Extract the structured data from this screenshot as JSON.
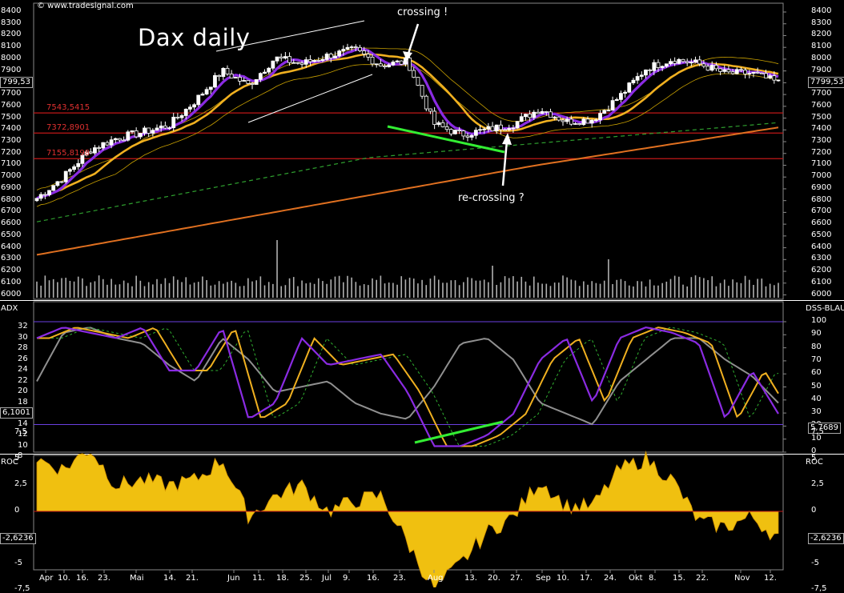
{
  "header": {
    "watermark": "© www.tradesignal.com",
    "title": "Dax daily"
  },
  "annotations": {
    "crossing": "crossing !",
    "recrossing": "re-crossing ?"
  },
  "price_panel": {
    "y_ticks": [
      "8400",
      "8300",
      "8200",
      "8100",
      "8000",
      "7900",
      "7800",
      "7700",
      "7600",
      "7500",
      "7400",
      "7300",
      "7200",
      "7100",
      "7000",
      "6900",
      "6800",
      "6700",
      "6600",
      "6500",
      "6400",
      "6300",
      "6200",
      "6100",
      "6000"
    ],
    "last_price": "7799,53",
    "last_price_left": "799,53",
    "levels": [
      {
        "label": "7543,5415",
        "value": 7543.5415
      },
      {
        "label": "7372,8901",
        "value": 7372.8901
      },
      {
        "label": "7155,8198",
        "value": 7155.8198
      }
    ]
  },
  "adx_panel": {
    "left_name": "ADX",
    "right_name": "DSS-BLAU",
    "left_ticks": [
      "32",
      "30",
      "28",
      "26",
      "24",
      "22",
      "20",
      "18",
      "16",
      "14",
      "12",
      "10",
      "8"
    ],
    "right_ticks": [
      "100",
      "90",
      "80",
      "70",
      "60",
      "50",
      "40",
      "30",
      "20",
      "10",
      "0"
    ],
    "left_value": "6,1001",
    "right_value": "5,7689"
  },
  "roc_panel": {
    "name": "ROC",
    "ticks": [
      "7,5",
      "5",
      "2,5",
      "0",
      "-2,5",
      "-5",
      "-7,5"
    ],
    "value": "-2,6236"
  },
  "x_axis": {
    "labels": [
      "Apr",
      "10.",
      "16.",
      "23.",
      "Mai",
      "14.",
      "21.",
      "Jun",
      "11.",
      "18.",
      "25.",
      "Jul",
      "9.",
      "16.",
      "23.",
      "Aug",
      "13.",
      "20.",
      "27.",
      "Sep",
      "10.",
      "17.",
      "24.",
      "Okt",
      "8.",
      "15.",
      "22.",
      "Nov",
      "12."
    ]
  },
  "colors": {
    "candle_up": "#ffffff",
    "candle_down": "#000000",
    "purple_line": "#8a2be2",
    "gold_line": "#f0b020",
    "green_dashed": "#2e9e2e",
    "orange_line": "#e07020",
    "level_line": "#c01818",
    "volume": "#b0b0b0",
    "roc_fill": "#f0c010",
    "trend_marker": "#33ee33"
  },
  "chart_data": [
    {
      "type": "line",
      "title": "Dax daily",
      "x": [
        "Apr",
        "10.",
        "16.",
        "23.",
        "Mai",
        "14.",
        "21.",
        "Jun",
        "11.",
        "18.",
        "25.",
        "Jul",
        "9.",
        "16.",
        "23.",
        "Aug",
        "13.",
        "20.",
        "27.",
        "Sep",
        "10.",
        "17.",
        "24.",
        "Okt",
        "8.",
        "15.",
        "22.",
        "Nov",
        "12."
      ],
      "series": [
        {
          "values": [
            6820,
            7000,
            7230,
            7330,
            7380,
            7440,
            7650,
            7900,
            7780,
            8010,
            7960,
            8030,
            8080,
            7950,
            7980,
            7450,
            7360,
            7400,
            7450,
            7580,
            7470,
            7490,
            7680,
            7920,
            8000,
            7960,
            7880,
            7880,
            7800
          ]
        }
      ],
      "ylim": [
        6000,
        8450
      ],
      "horizontal_levels": [
        7543.5415,
        7372.8901,
        7155.8198
      ]
    },
    {
      "type": "line",
      "title": "ADX / DSS",
      "series": [
        {
          "values": [
            30,
            32,
            31,
            30,
            32,
            24,
            24,
            32,
            15,
            18,
            30,
            25,
            26,
            27,
            20,
            10,
            10,
            12,
            16,
            26,
            30,
            18,
            30,
            32,
            31,
            29,
            15,
            24,
            16
          ]
        },
        {
          "values": [
            22,
            31,
            32,
            30,
            29,
            25,
            22,
            30,
            26,
            20,
            21,
            22,
            18,
            16,
            15,
            21,
            29,
            30,
            26,
            18,
            16,
            14,
            22,
            26,
            30,
            30,
            26,
            23,
            18
          ]
        }
      ],
      "ylim": [
        8,
        34
      ]
    },
    {
      "type": "area",
      "title": "ROC",
      "series": [
        {
          "values": [
            5,
            4,
            6,
            2.5,
            3,
            2.5,
            3,
            5,
            -0.5,
            1.5,
            2.5,
            0,
            1,
            1.5,
            -3,
            -7.5,
            -5,
            -2,
            -0.5,
            3,
            0.5,
            0.5,
            4,
            5,
            3,
            -1,
            -1.5,
            -0.5,
            -2.6
          ]
        }
      ],
      "ylim": [
        -8.5,
        8.5
      ]
    }
  ]
}
